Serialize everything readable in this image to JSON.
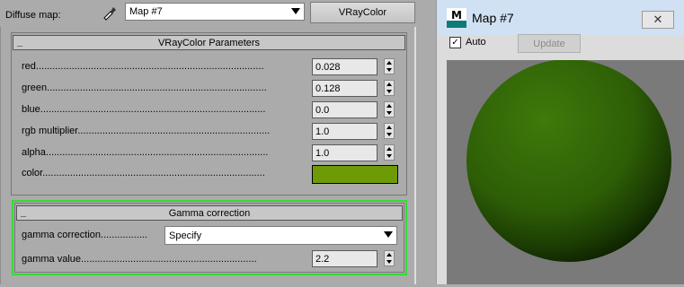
{
  "header": {
    "diffuse_label": "Diffuse map:",
    "map_combo": "Map #7",
    "type_button": "VRayColor"
  },
  "params": {
    "title": "VRayColor Parameters",
    "toggle": "_",
    "rows": [
      {
        "label": "red...................................................................................",
        "value": "0.028"
      },
      {
        "label": "green................................................................................",
        "value": "0.128"
      },
      {
        "label": "blue..................................................................................",
        "value": "0.0"
      },
      {
        "label": "rgb multiplier......................................................................",
        "value": "1.0"
      },
      {
        "label": "alpha.................................................................................",
        "value": "1.0"
      }
    ],
    "color_label": "color.................................................................................",
    "color_hex": "#6e9a06"
  },
  "gamma": {
    "title": "Gamma correction",
    "toggle": "_",
    "correction_label": "gamma correction.................",
    "correction_value": "Specify",
    "value_label": "gamma value................................................................",
    "value": "2.2"
  },
  "preview_window": {
    "title": "Map #7",
    "close": "✕",
    "auto_label": "Auto",
    "auto_checked": "✓",
    "update_button": "Update",
    "sphere_color": "#2f5f06"
  }
}
